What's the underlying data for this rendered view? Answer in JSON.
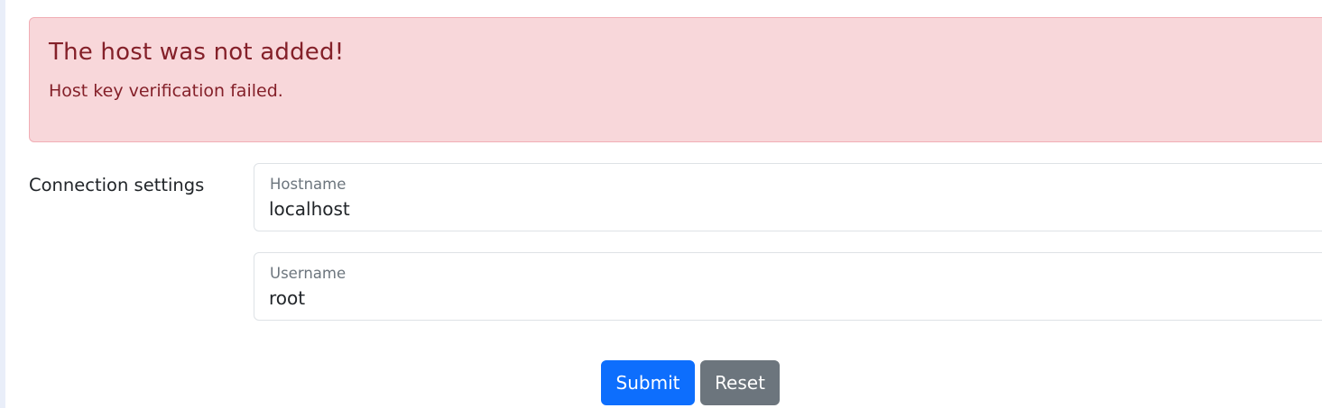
{
  "alert": {
    "title": "The host was not added!",
    "message": "Host key verification failed."
  },
  "form": {
    "section_label": "Connection settings",
    "hostname": {
      "label": "Hostname",
      "value": "localhost"
    },
    "username": {
      "label": "Username",
      "value": "root"
    }
  },
  "buttons": {
    "submit_label": "Submit",
    "reset_label": "Reset"
  },
  "colors": {
    "alert_background": "#f8d7da",
    "alert_text": "#842029",
    "primary": "#0d6efd",
    "secondary": "#6c757d"
  }
}
